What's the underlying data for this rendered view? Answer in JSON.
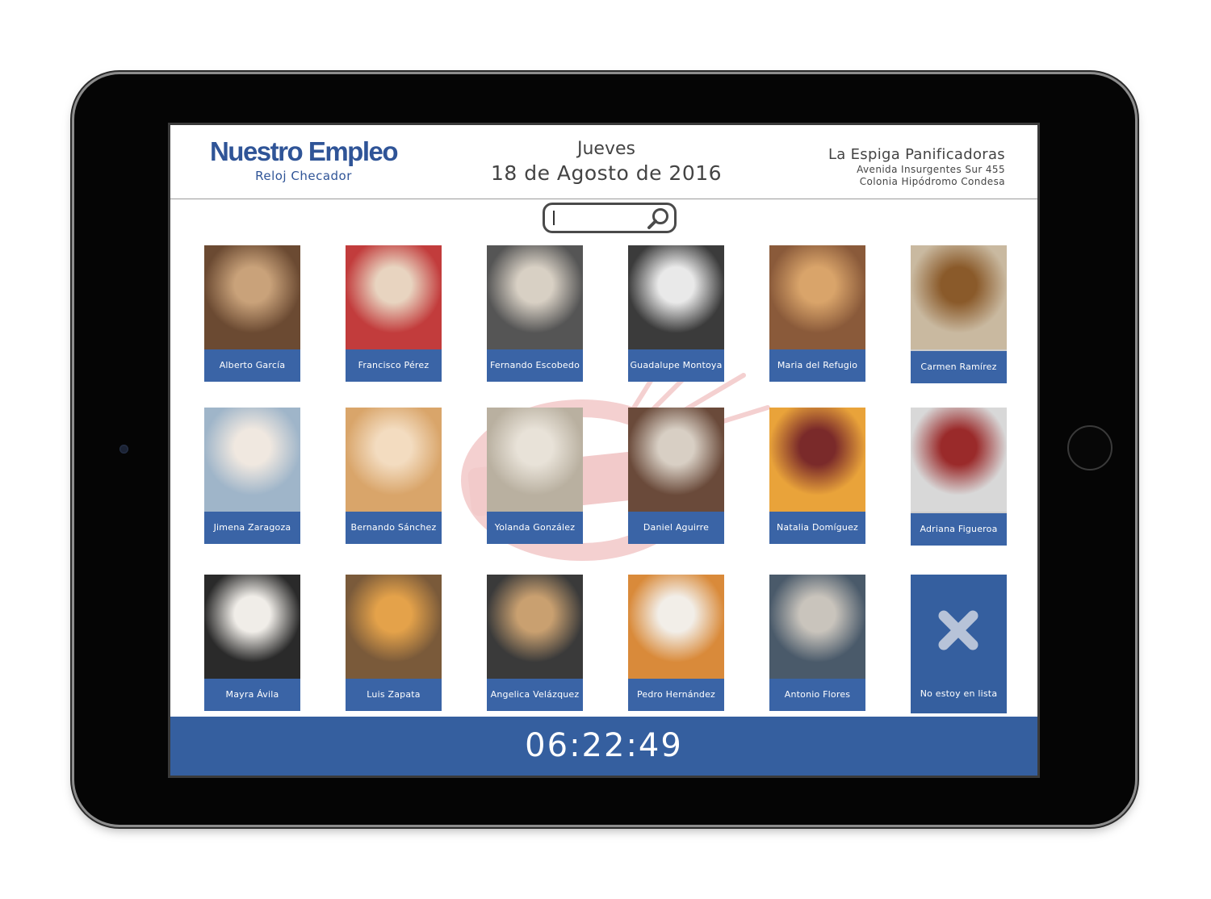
{
  "header": {
    "brand_title": "Nuestro Empleo",
    "brand_subtitle": "Reloj Checador",
    "day": "Jueves",
    "date": "18 de Agosto de 2016",
    "company_name": "La Espiga Panificadoras",
    "address_line1": "Avenida Insurgentes Sur 455",
    "address_line2": "Colonia Hipódromo Condesa"
  },
  "search": {
    "value": "",
    "placeholder": ""
  },
  "employees": [
    {
      "name": "Alberto García"
    },
    {
      "name": "Francisco Pérez"
    },
    {
      "name": "Fernando Escobedo"
    },
    {
      "name": "Guadalupe Montoya"
    },
    {
      "name": "Maria del Refugio"
    },
    {
      "name": "Carmen Ramírez"
    },
    {
      "name": "Jimena Zaragoza"
    },
    {
      "name": "Bernando Sánchez"
    },
    {
      "name": "Yolanda González"
    },
    {
      "name": "Daniel Aguirre"
    },
    {
      "name": "Natalia Domíguez"
    },
    {
      "name": "Adriana Figueroa"
    },
    {
      "name": "Mayra Ávila"
    },
    {
      "name": "Luis Zapata"
    },
    {
      "name": "Angelica Velázquez"
    },
    {
      "name": "Pedro Hernández"
    },
    {
      "name": "Antonio Flores"
    }
  ],
  "not_listed_label": "No estoy en lista",
  "clock": "06:22:49",
  "colors": {
    "brand_blue": "#2f5497",
    "tile_blue": "#3a64a6",
    "footer_blue": "#355f9f"
  }
}
